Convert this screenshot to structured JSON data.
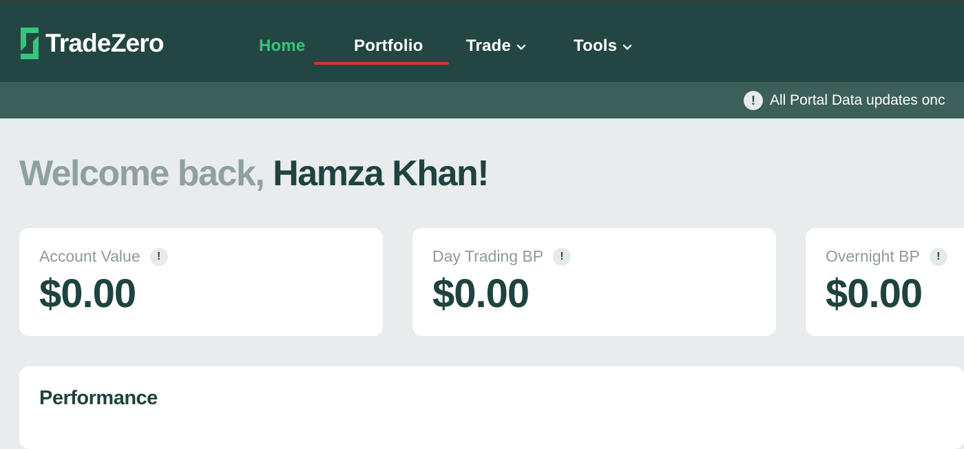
{
  "brand": {
    "name": "TradeZero",
    "accent": "#35c57f",
    "nav_bg": "#234642",
    "underline_color": "#d9352a"
  },
  "nav": {
    "items": [
      {
        "label": "Home",
        "active": true
      },
      {
        "label": "Portfolio",
        "active": false
      },
      {
        "label": "Trade",
        "dropdown": true
      },
      {
        "label": "Tools",
        "dropdown": true
      }
    ]
  },
  "notice": {
    "icon": "exclamation-icon",
    "text": "All Portal Data updates onc"
  },
  "welcome": {
    "greeting": "Welcome back,",
    "name": "Hamza Khan!"
  },
  "cards": [
    {
      "label": "Account Value",
      "value": "$0.00",
      "icon": "info-icon"
    },
    {
      "label": "Day Trading BP",
      "value": "$0.00",
      "icon": "info-icon"
    },
    {
      "label": "Overnight BP",
      "value": "$0.00",
      "icon": "info-icon"
    }
  ],
  "performance": {
    "title": "Performance"
  }
}
